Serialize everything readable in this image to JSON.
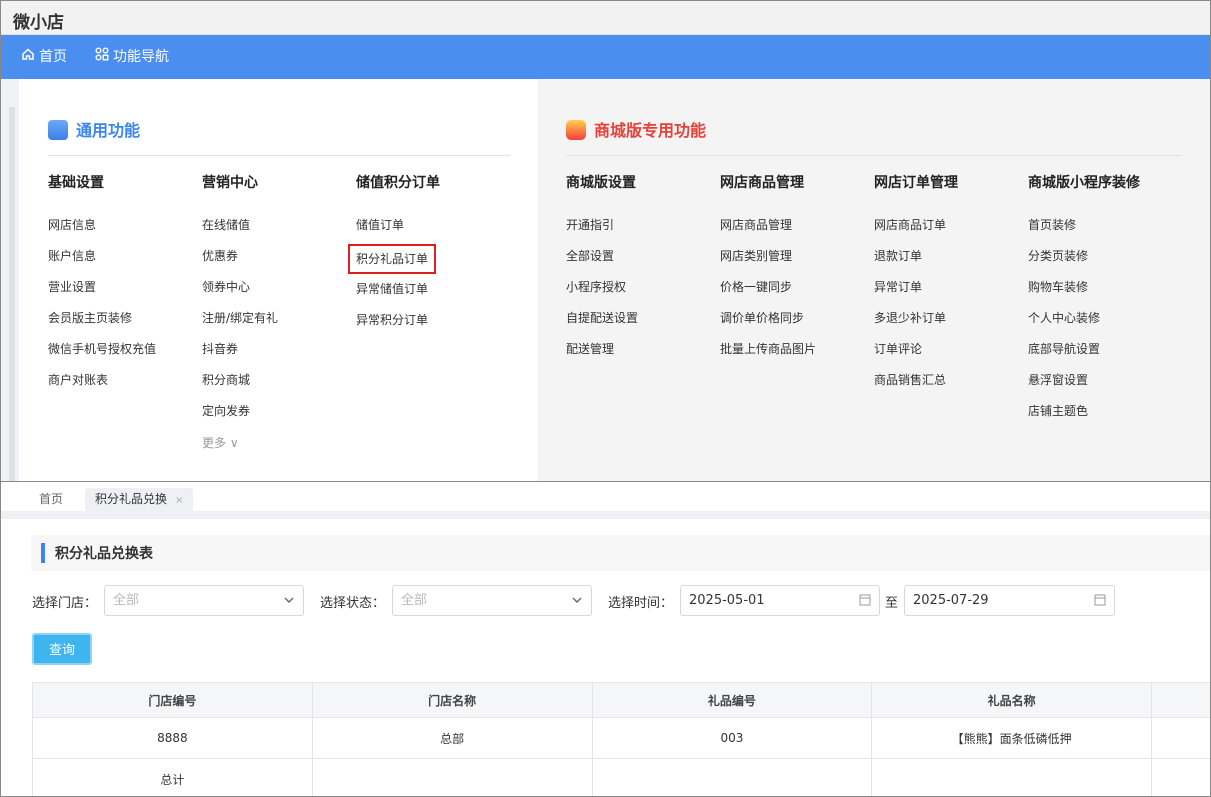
{
  "app": {
    "title": "微小店"
  },
  "nav": {
    "home": "首页",
    "func_nav": "功能导航"
  },
  "menu": {
    "general": {
      "title": "通用功能",
      "columns": [
        {
          "title": "基础设置",
          "items": [
            "网店信息",
            "账户信息",
            "营业设置",
            "会员版主页装修",
            "微信手机号授权充值",
            "商户对账表"
          ]
        },
        {
          "title": "营销中心",
          "items": [
            "在线储值",
            "优惠券",
            "领券中心",
            "注册/绑定有礼",
            "抖音券",
            "积分商城",
            "定向发券"
          ],
          "more": "更多"
        },
        {
          "title": "储值积分订单",
          "items": [
            "储值订单",
            "积分礼品订单",
            "异常储值订单",
            "异常积分订单"
          ]
        }
      ]
    },
    "mall": {
      "title": "商城版专用功能",
      "columns": [
        {
          "title": "商城版设置",
          "items": [
            "开通指引",
            "全部设置",
            "小程序授权",
            "自提配送设置",
            "配送管理"
          ]
        },
        {
          "title": "网店商品管理",
          "items": [
            "网店商品管理",
            "网店类别管理",
            "价格一键同步",
            "调价单价格同步",
            "批量上传商品图片"
          ]
        },
        {
          "title": "网店订单管理",
          "items": [
            "网店商品订单",
            "退款订单",
            "异常订单",
            "多退少补订单",
            "订单评论",
            "商品销售汇总"
          ]
        },
        {
          "title": "商城版小程序装修",
          "items": [
            "首页装修",
            "分类页装修",
            "购物车装修",
            "个人中心装修",
            "底部导航设置",
            "悬浮窗设置",
            "店铺主题色"
          ]
        }
      ]
    }
  },
  "tabs": {
    "home": "首页",
    "active": "积分礼品兑换",
    "close": "×"
  },
  "panel": {
    "title": "积分礼品兑换表",
    "store_label": "选择门店：",
    "store_value": "全部",
    "status_label": "选择状态：",
    "status_value": "全部",
    "time_label": "选择时间：",
    "date_from": "2025-05-01",
    "date_sep": "至",
    "date_to": "2025-07-29",
    "query_button": "查询"
  },
  "table": {
    "headers": [
      "门店编号",
      "门店名称",
      "礼品编号",
      "礼品名称",
      ""
    ],
    "rows": [
      [
        "8888",
        "总部",
        "003",
        "【熊熊】面条低磷低押",
        ""
      ],
      [
        "总计",
        "",
        "",
        "",
        ""
      ]
    ]
  },
  "colors": {
    "nav_bg": "#4a8ef0",
    "general_title": "#3b86f0",
    "mall_title": "#e8413a",
    "query_btn": "#3fb5f0",
    "highlight_box": "#e02020"
  }
}
